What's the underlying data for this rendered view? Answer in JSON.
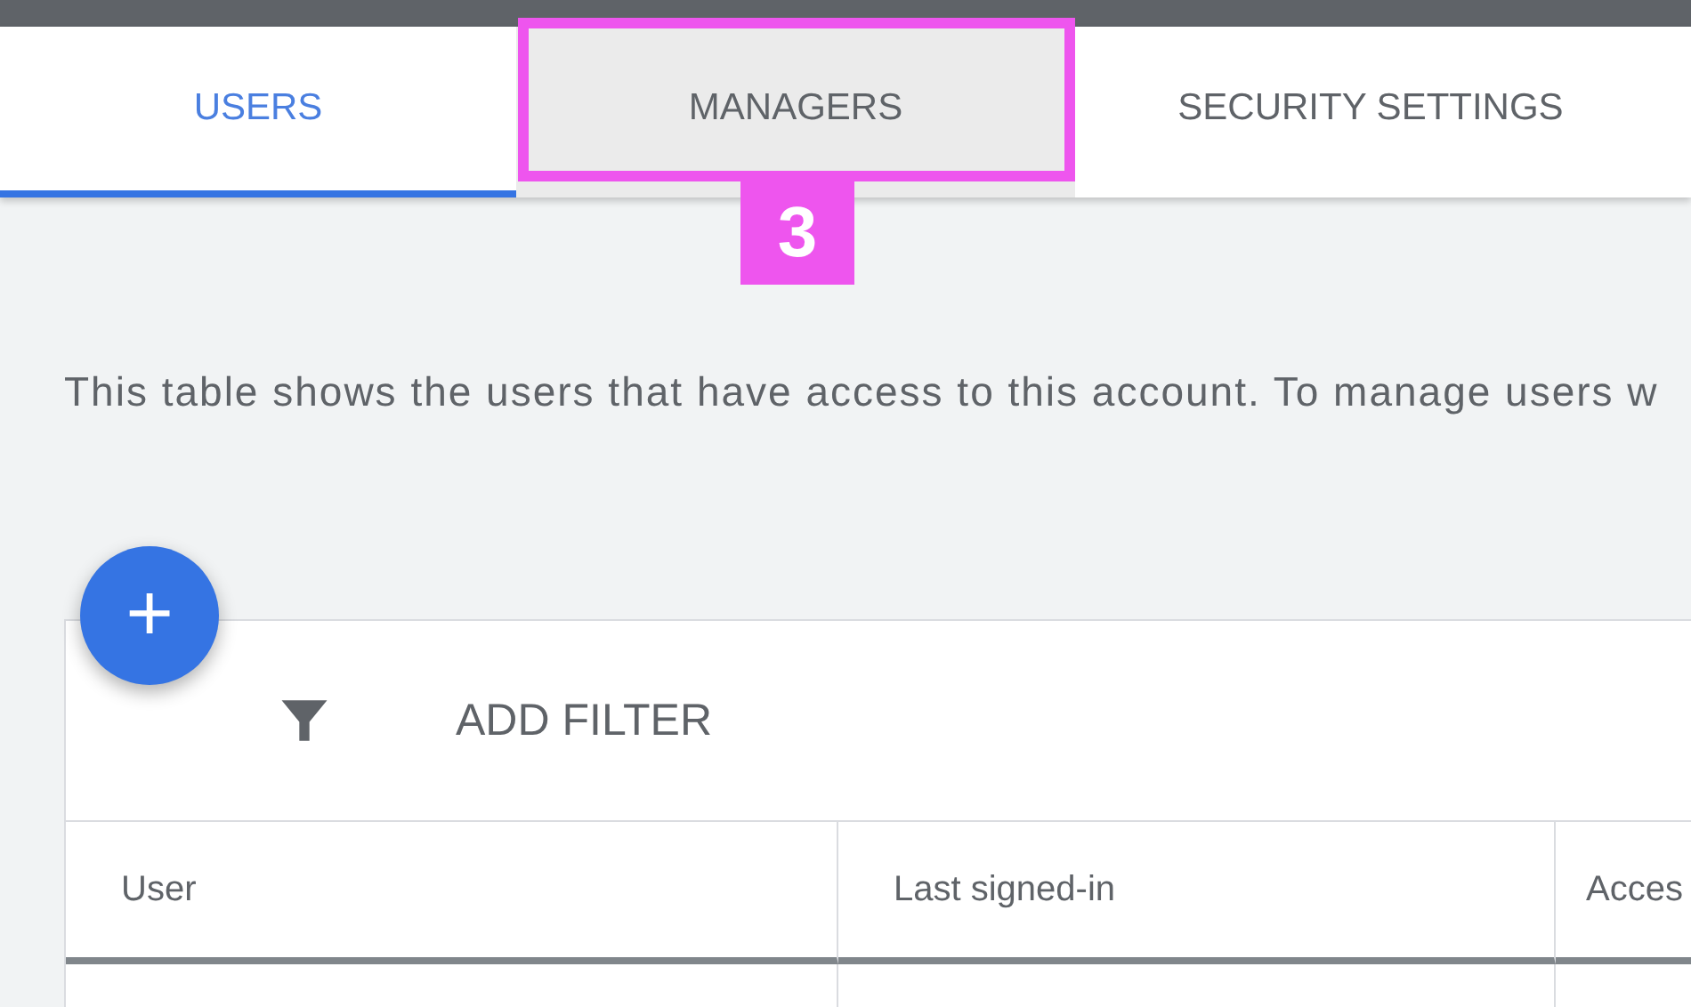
{
  "tabs": [
    {
      "label": "USERS",
      "selected": true,
      "highlighted": false
    },
    {
      "label": "MANAGERS",
      "selected": false,
      "highlighted": true
    },
    {
      "label": "SECURITY SETTINGS",
      "selected": false,
      "highlighted": false
    }
  ],
  "callout": {
    "label": "3"
  },
  "description": "This table shows the users that have access to this account. To manage users w",
  "add_button": {
    "label": "+"
  },
  "filter": {
    "label": "ADD FILTER"
  },
  "table": {
    "columns": [
      "User",
      "Last signed-in",
      "Acces"
    ]
  }
}
